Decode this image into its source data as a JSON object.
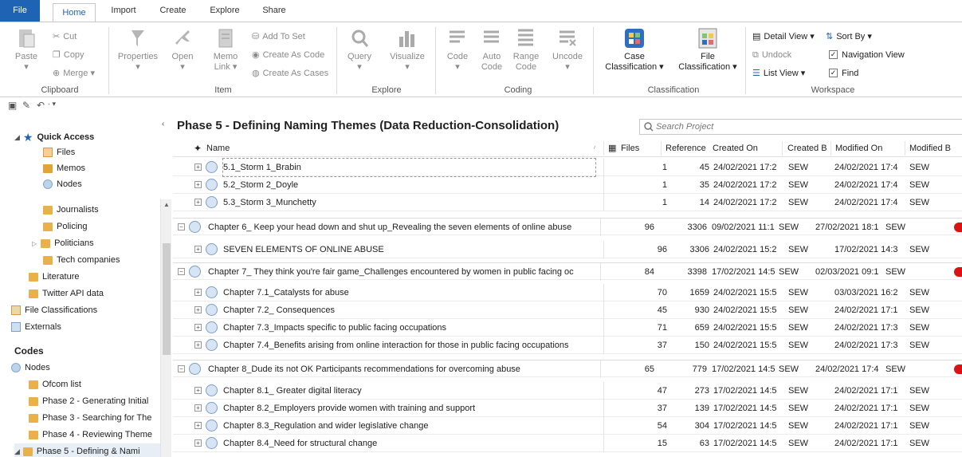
{
  "ribbon": {
    "tabs": [
      "File",
      "Home",
      "Import",
      "Create",
      "Explore",
      "Share"
    ],
    "clipboard": {
      "paste": "Paste",
      "cut": "Cut",
      "copy": "Copy",
      "merge": "Merge",
      "label": "Clipboard"
    },
    "item": {
      "properties": "Properties",
      "open": "Open",
      "memo_link_1": "Memo",
      "memo_link_2": "Link",
      "add_to_set": "Add To Set",
      "create_as_code": "Create As Code",
      "create_as_cases": "Create As Cases",
      "label": "Item"
    },
    "explore": {
      "query": "Query",
      "visualize": "Visualize",
      "label": "Explore"
    },
    "coding": {
      "code": "Code",
      "auto_1": "Auto",
      "auto_2": "Code",
      "range_1": "Range",
      "range_2": "Code",
      "uncode": "Uncode",
      "label": "Coding"
    },
    "classification": {
      "case_1": "Case",
      "case_2": "Classification",
      "file_1": "File",
      "file_2": "Classification",
      "label": "Classification"
    },
    "workspace": {
      "detail_view": "Detail View",
      "sort_by": "Sort By",
      "undock": "Undock",
      "navigation_view": "Navigation View",
      "list_view": "List View",
      "find": "Find",
      "label": "Workspace"
    }
  },
  "nav": {
    "quick_access": "Quick Access",
    "files": "Files",
    "memos": "Memos",
    "nodes_qa": "Nodes",
    "journalists": "Journalists",
    "policing": "Policing",
    "politicians": "Politicians",
    "tech_companies": "Tech companies",
    "literature": "Literature",
    "twitter_api": "Twitter API data",
    "file_classifications": "File Classifications",
    "externals": "Externals",
    "codes": "Codes",
    "nodes": "Nodes",
    "ofcom": "Ofcom list",
    "phase2": "Phase 2 - Generating Initial",
    "phase3": "Phase 3 - Searching for The",
    "phase4": "Phase 4 - Reviewing Theme",
    "phase5": "Phase 5 - Defining & Nami"
  },
  "main": {
    "title": "Phase 5 - Defining  Naming Themes (Data Reduction-Consolidation)",
    "search_placeholder": "Search Project",
    "columns": {
      "name": "Name",
      "files": "Files",
      "reference": "Reference",
      "created_on": "Created On",
      "created_by": "Created B",
      "modified_on": "Modified On",
      "modified_by": "Modified B"
    },
    "rows": [
      {
        "name": "5.1_Storm 1_Brabin",
        "files": "1",
        "refs": "45",
        "created": "24/02/2021 17:2",
        "cby": "SEW",
        "modified": "24/02/2021 17:4",
        "mby": "SEW"
      },
      {
        "name": "5.2_Storm 2_Doyle",
        "files": "1",
        "refs": "35",
        "created": "24/02/2021 17:2",
        "cby": "SEW",
        "modified": "24/02/2021 17:4",
        "mby": "SEW"
      },
      {
        "name": "5.3_Storm 3_Munchetty",
        "files": "1",
        "refs": "14",
        "created": "24/02/2021 17:2",
        "cby": "SEW",
        "modified": "24/02/2021 17:4",
        "mby": "SEW"
      },
      {
        "name": "Chapter 6_ Keep your head down and shut up_Revealing the seven elements of online abuse",
        "files": "96",
        "refs": "3306",
        "created": "09/02/2021 11:1",
        "cby": "SEW",
        "modified": "27/02/2021 18:1",
        "mby": "SEW"
      },
      {
        "name": "SEVEN ELEMENTS OF ONLINE ABUSE",
        "files": "96",
        "refs": "3306",
        "created": "24/02/2021 15:2",
        "cby": "SEW",
        "modified": "17/02/2021 14:3",
        "mby": "SEW"
      },
      {
        "name": "Chapter 7_ They think you're fair game_Challenges encountered by women in public facing oc",
        "files": "84",
        "refs": "3398",
        "created": "17/02/2021 14:5",
        "cby": "SEW",
        "modified": "02/03/2021 09:1",
        "mby": "SEW"
      },
      {
        "name": "Chapter 7.1_Catalysts for abuse",
        "files": "70",
        "refs": "1659",
        "created": "24/02/2021 15:5",
        "cby": "SEW",
        "modified": "03/03/2021 16:2",
        "mby": "SEW"
      },
      {
        "name": "Chapter 7.2_ Consequences",
        "files": "45",
        "refs": "930",
        "created": "24/02/2021 15:5",
        "cby": "SEW",
        "modified": "24/02/2021 17:1",
        "mby": "SEW"
      },
      {
        "name": "Chapter 7.3_Impacts specific to public facing occupations",
        "files": "71",
        "refs": "659",
        "created": "24/02/2021 15:5",
        "cby": "SEW",
        "modified": "24/02/2021 17:3",
        "mby": "SEW"
      },
      {
        "name": "Chapter 7.4_Benefits arising from online interaction for those in public facing occupations",
        "files": "37",
        "refs": "150",
        "created": "24/02/2021 15:5",
        "cby": "SEW",
        "modified": "24/02/2021 17:3",
        "mby": "SEW"
      },
      {
        "name": "Chapter 8_Dude its not OK Participants recommendations for overcoming abuse",
        "files": "65",
        "refs": "779",
        "created": "17/02/2021 14:5",
        "cby": "SEW",
        "modified": "24/02/2021 17:4",
        "mby": "SEW"
      },
      {
        "name": "Chapter 8.1_ Greater digital literacy",
        "files": "47",
        "refs": "273",
        "created": "17/02/2021 14:5",
        "cby": "SEW",
        "modified": "24/02/2021 17:1",
        "mby": "SEW"
      },
      {
        "name": "Chapter 8.2_Employers provide women with training and support",
        "files": "37",
        "refs": "139",
        "created": "17/02/2021 14:5",
        "cby": "SEW",
        "modified": "24/02/2021 17:1",
        "mby": "SEW"
      },
      {
        "name": "Chapter 8.3_Regulation and wider legislative change",
        "files": "54",
        "refs": "304",
        "created": "17/02/2021 14:5",
        "cby": "SEW",
        "modified": "24/02/2021 17:1",
        "mby": "SEW"
      },
      {
        "name": "Chapter 8.4_Need for structural change",
        "files": "15",
        "refs": "63",
        "created": "17/02/2021 14:5",
        "cby": "SEW",
        "modified": "24/02/2021 17:1",
        "mby": "SEW"
      }
    ]
  },
  "colors": {
    "accent": "#1f63b5",
    "folder": "#e8b14a",
    "node": "#d6e4f3",
    "alert": "#dd1111"
  }
}
